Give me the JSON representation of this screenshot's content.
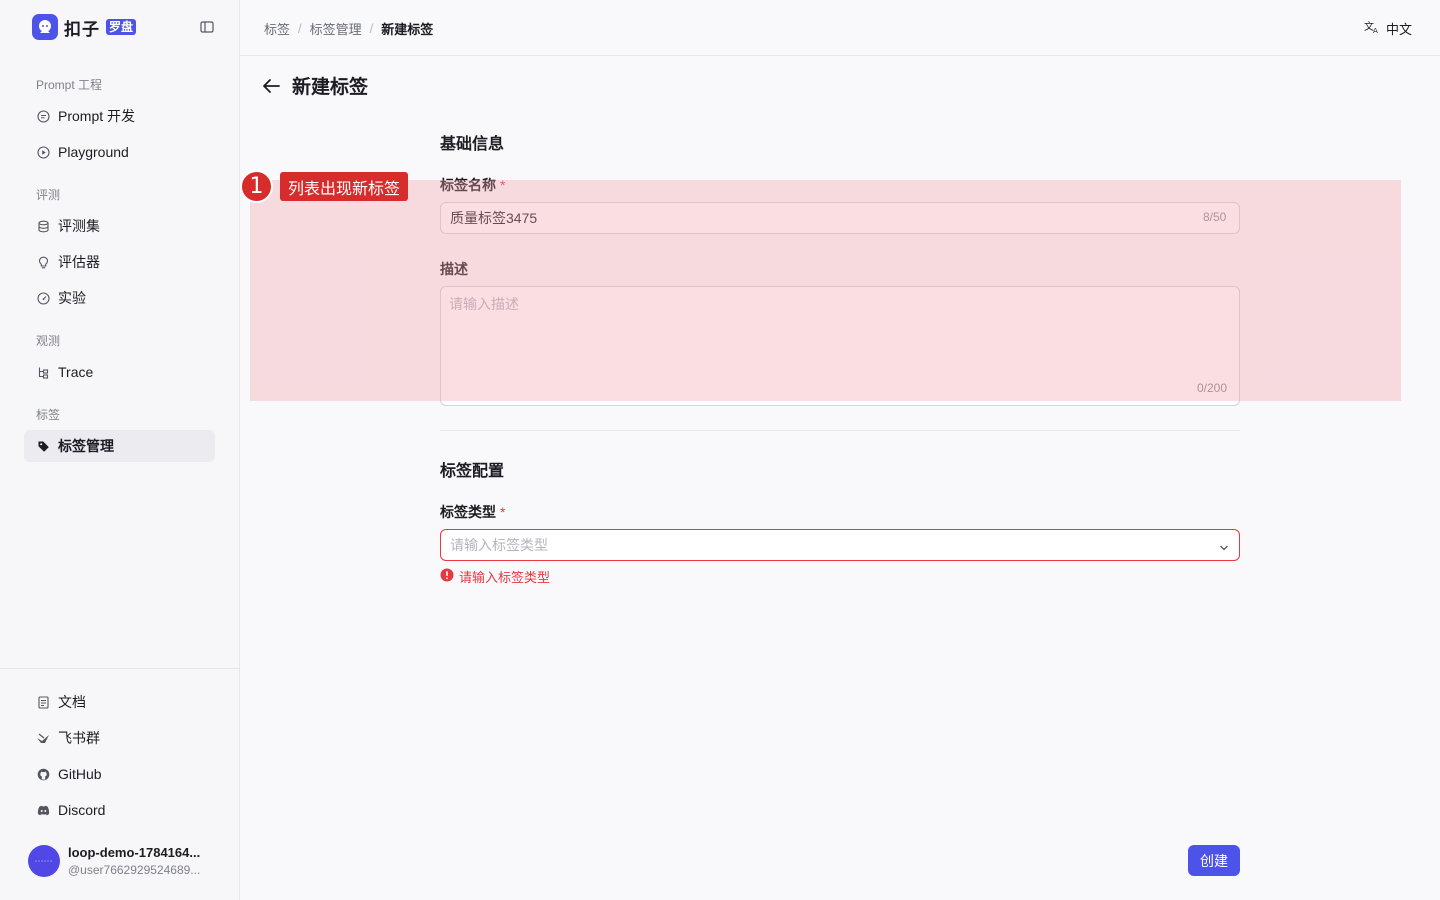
{
  "app": {
    "logo_text": "扣子",
    "logo_badge": "罗盘"
  },
  "sidebar": {
    "groups": [
      {
        "title": "Prompt 工程",
        "items": [
          {
            "label": "Prompt 开发"
          },
          {
            "label": "Playground"
          }
        ]
      },
      {
        "title": "评测",
        "items": [
          {
            "label": "评测集"
          },
          {
            "label": "评估器"
          },
          {
            "label": "实验"
          }
        ]
      },
      {
        "title": "观测",
        "items": [
          {
            "label": "Trace"
          }
        ]
      },
      {
        "title": "标签",
        "items": [
          {
            "label": "标签管理",
            "active": true
          }
        ]
      }
    ],
    "footer_items": [
      {
        "label": "文档"
      },
      {
        "label": "飞书群"
      },
      {
        "label": "GitHub"
      },
      {
        "label": "Discord"
      }
    ],
    "user": {
      "name": "loop-demo-1784164...",
      "handle": "@user7662929524689..."
    }
  },
  "header": {
    "breadcrumb": [
      "标签",
      "标签管理",
      "新建标签"
    ],
    "language": "中文"
  },
  "page": {
    "title": "新建标签",
    "basic_section": "基础信息",
    "name_label": "标签名称",
    "required_mark": "*",
    "name_value": "质量标签3475",
    "name_counter": "8/50",
    "desc_label": "描述",
    "desc_placeholder": "请输入描述",
    "desc_counter": "0/200",
    "config_section": "标签配置",
    "type_label": "标签类型",
    "type_placeholder": "请输入标签类型",
    "type_error": "请输入标签类型",
    "create_button": "创建"
  },
  "annotation": {
    "step": "1",
    "text": "列表出现新标签",
    "color": "#d62c2c"
  },
  "colors": {
    "brand": "#4d53e8",
    "error": "#e5383f"
  }
}
